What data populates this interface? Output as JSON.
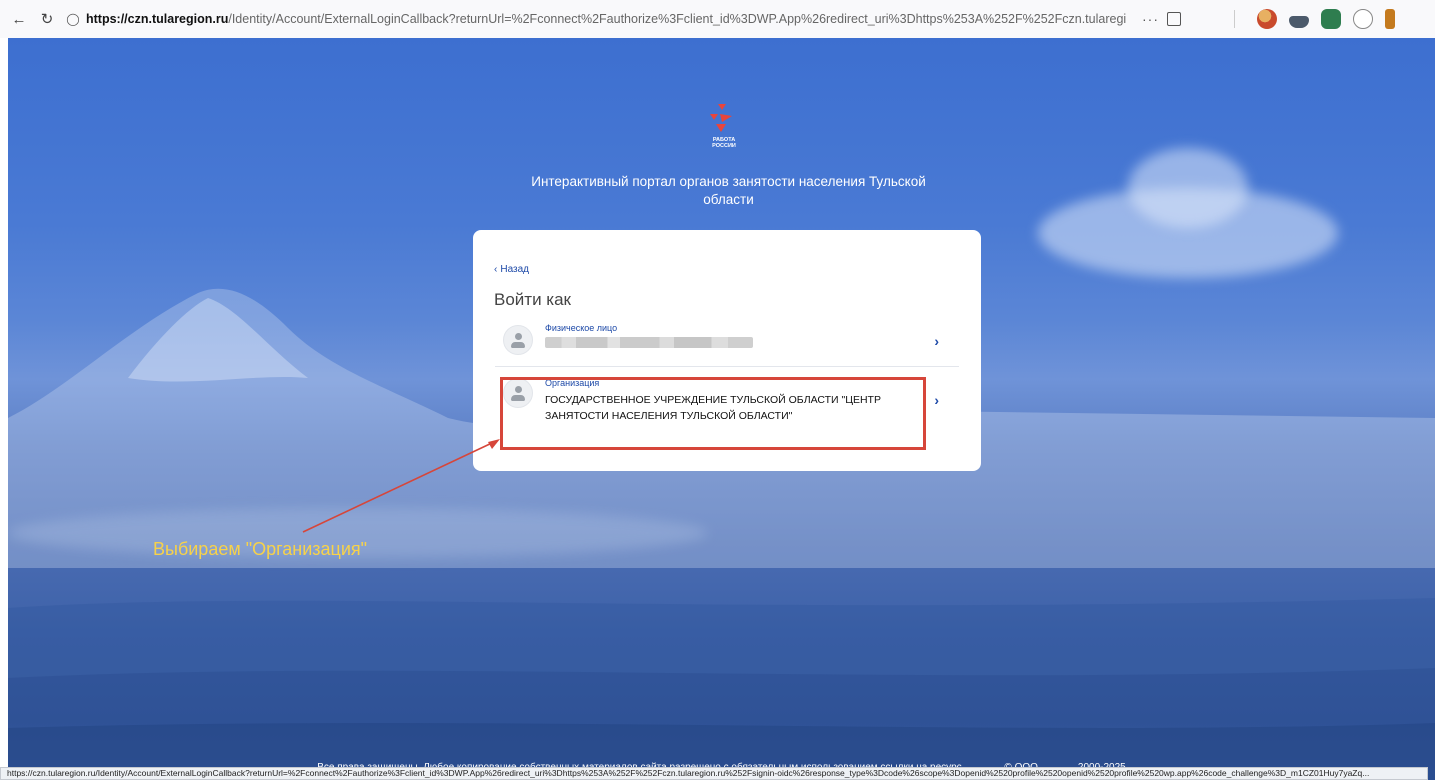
{
  "browser": {
    "url_domain": "https://czn.tularegion.ru",
    "url_rest": "/Identity/Account/ExternalLoginCallback?returnUrl=%2Fconnect%2Fauthorize%3Fclient_id%3DWP.App%26redirect_uri%3Dhttps%253A%252F%252Fczn.tularegion.ru%252Fsignin-oidc%2...",
    "more_label": "···",
    "status_url": "https://czn.tularegion.ru/Identity/Account/ExternalLoginCallback?returnUrl=%2Fconnect%2Fauthorize%3Fclient_id%3DWP.App%26redirect_uri%3Dhttps%253A%252F%252Fczn.tularegion.ru%252Fsignin-oidc%26response_type%3Dcode%26scope%3Dopenid%2520profile%2520openid%2520profile%2520wp.app%26code_challenge%3D_m1CZ01Huy7yaZq..."
  },
  "logo": {
    "line1": "РАБОТА",
    "line2": "РОССИИ",
    "icon": "rabota-rossii-logo-icon"
  },
  "portal_title": "Интерактивный портал органов занятости населения Тульской области",
  "card": {
    "back_label": "Назад",
    "title": "Войти как",
    "options": [
      {
        "label": "Физическое лицо",
        "name_hidden": true
      },
      {
        "label": "Организация",
        "name": "ГОСУДАРСТВЕННОЕ УЧРЕЖДЕНИЕ ТУЛЬСКОЙ ОБЛАСТИ \"ЦЕНТР ЗАНЯТОСТИ НАСЕЛЕНИЯ ТУЛЬСКОЙ ОБЛАСТИ\""
      }
    ]
  },
  "annotation": {
    "text": "Выбираем \"Организация\"",
    "color": "#f7d24a",
    "box_color": "#d6463a"
  },
  "footer": {
    "rights": "Все права защищены. Любое копирование собственных материалов сайта разрешено с обязательным использованием ссылки на ресурс.",
    "copyright": "© ООО",
    "years": "2000-2025"
  },
  "colors": {
    "accent": "#1e4aa8",
    "background": "#4a7ad4"
  }
}
